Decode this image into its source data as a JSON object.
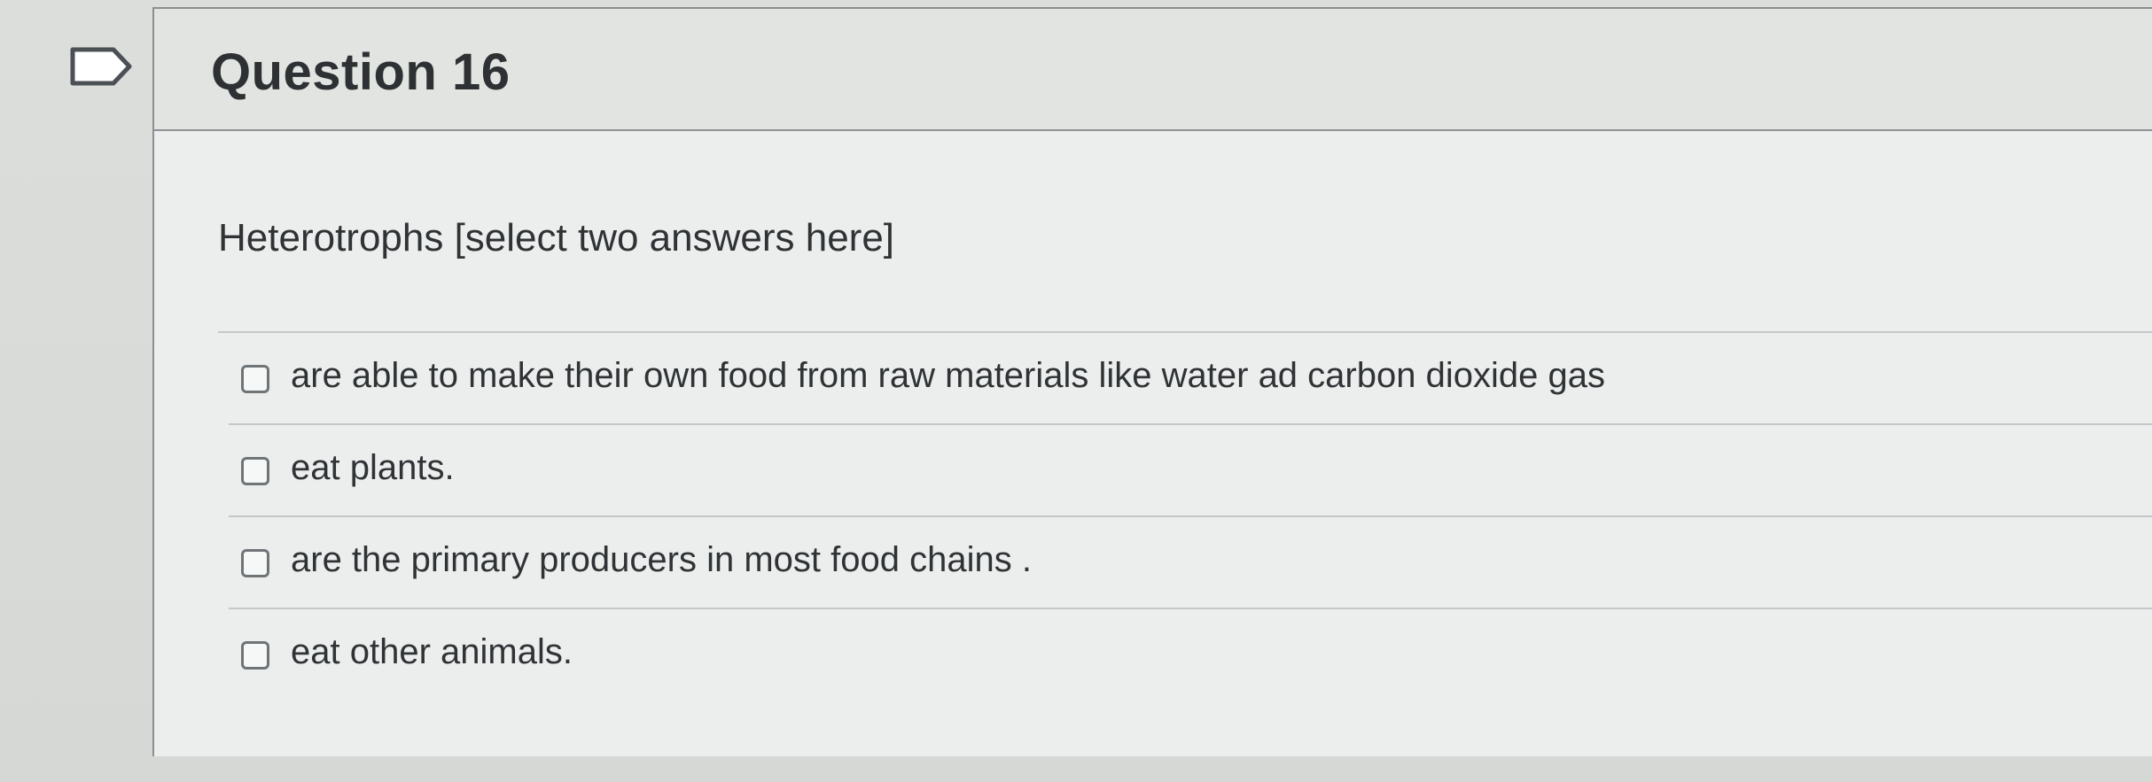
{
  "question": {
    "title": "Question 16",
    "prompt": "Heterotrophs [select two answers here]"
  },
  "answers": [
    {
      "label": "are able to make their own food from raw materials like water ad carbon dioxide gas"
    },
    {
      "label": "eat plants."
    },
    {
      "label": "are the primary producers in most food chains ."
    },
    {
      "label": "eat other animals."
    }
  ],
  "icons": {
    "flag": "flag-icon",
    "checkbox": "checkbox-unchecked"
  }
}
